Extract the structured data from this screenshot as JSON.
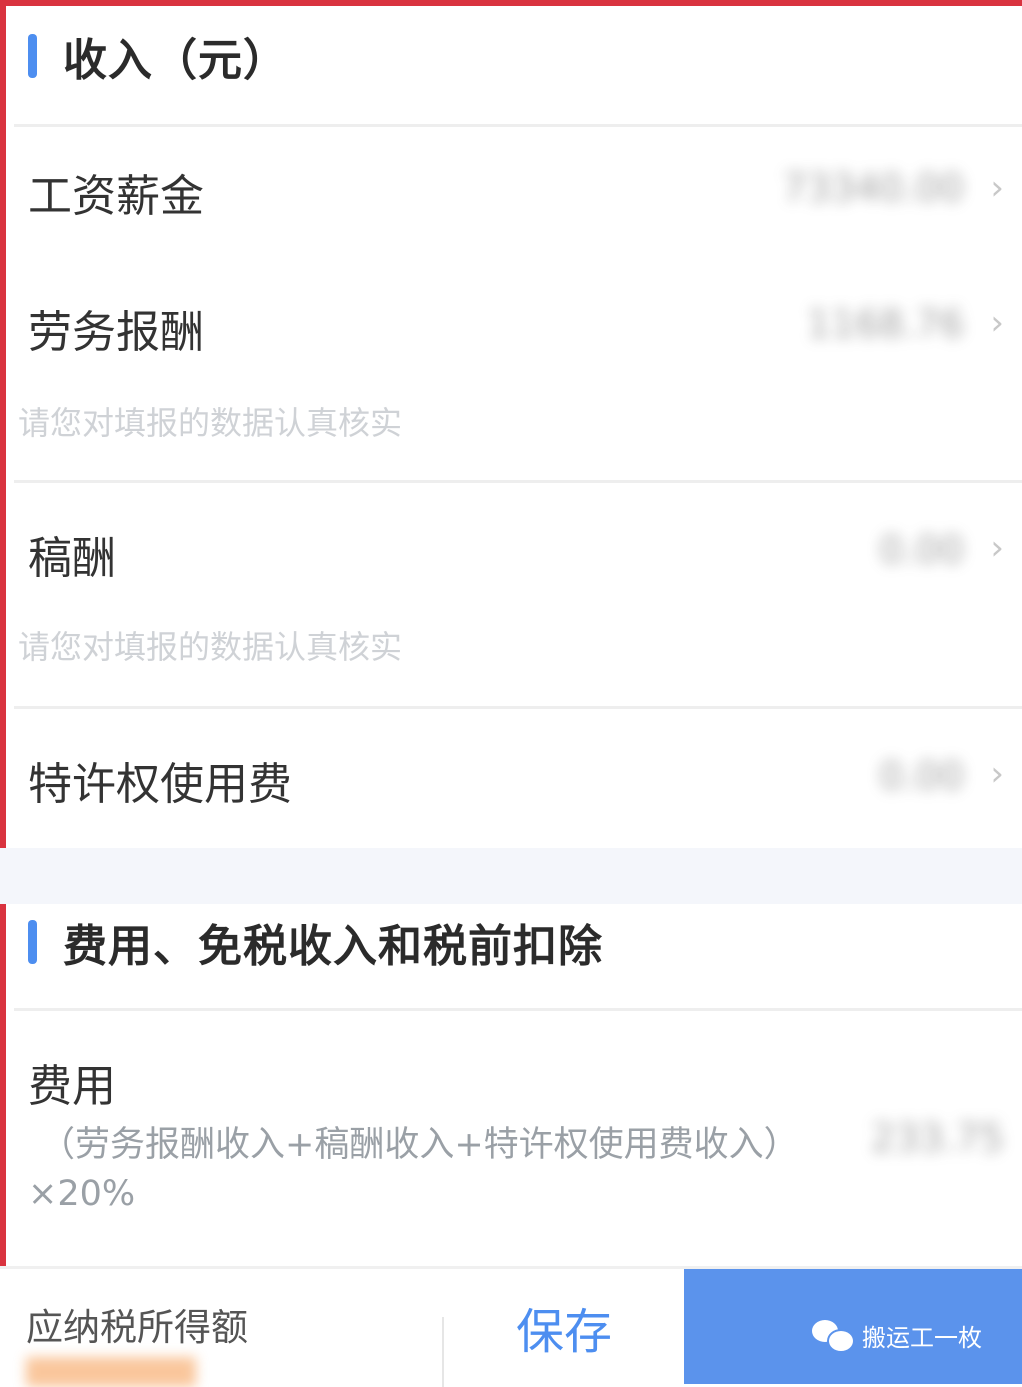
{
  "income": {
    "title": "收入（元）",
    "rows": [
      {
        "label": "工资薪金",
        "value": "73340.00"
      },
      {
        "label": "劳务报酬",
        "value": "1168.76",
        "hint": "请您对填报的数据认真核实"
      },
      {
        "label": "稿酬",
        "value": "0.00",
        "hint": "请您对填报的数据认真核实"
      },
      {
        "label": "特许权使用费",
        "value": "0.00"
      }
    ]
  },
  "deductions": {
    "title": "费用、免税收入和税前扣除",
    "expense": {
      "label": "费用",
      "formula": "（劳务报酬收入+稿酬收入+特许权使用费收入）",
      "rate": "×20%",
      "value": "233.75"
    }
  },
  "footer": {
    "taxable_label": "应纳税所得额",
    "save_label": "保存",
    "watermark": "搬运工一枚"
  },
  "colors": {
    "accent": "#4d8ef0",
    "frame": "#d9333f",
    "primary": "#5b93ec"
  }
}
